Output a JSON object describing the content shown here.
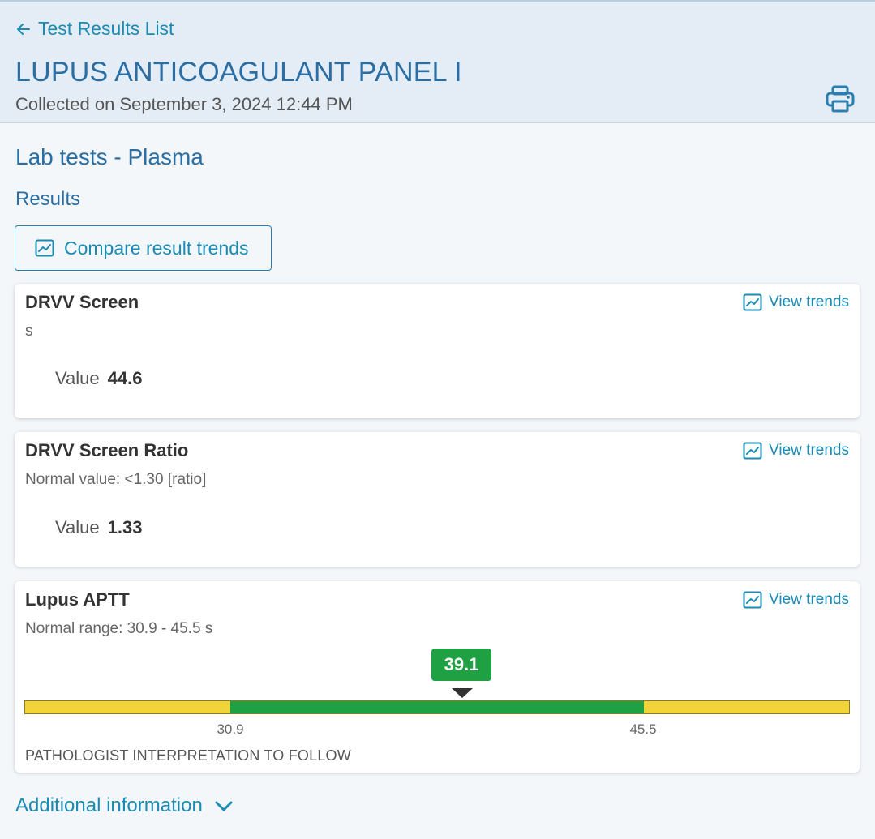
{
  "header": {
    "back_label": "Test Results List",
    "title": "LUPUS ANTICOAGULANT PANEL I",
    "collected": "Collected on September 3, 2024 12:44 PM",
    "print_icon": "printer-icon"
  },
  "section_title": "Lab tests - Plasma",
  "results_title": "Results",
  "compare_button": {
    "label": "Compare result trends",
    "icon": "trend-chart-icon"
  },
  "colors": {
    "accent": "#1a8bb3",
    "title": "#2a6ea3",
    "normal": "#1ea043",
    "abnormal": "#f2d43a"
  },
  "results": [
    {
      "name": "DRVV Screen",
      "subtitle": "s",
      "value_label": "Value",
      "value": "44.6",
      "trend_label": "View trends"
    },
    {
      "name": "DRVV Screen Ratio",
      "subtitle": "Normal value: <1.30 [ratio]",
      "value_label": "Value",
      "value": "1.33",
      "trend_label": "View trends"
    },
    {
      "name": "Lupus APTT",
      "subtitle": "Normal range: 30.9 - 45.5 s",
      "value": "39.1",
      "range_low": "30.9",
      "range_high": "45.5",
      "interpretation": "PATHOLOGIST INTERPRETATION TO FOLLOW",
      "trend_label": "View trends"
    }
  ],
  "additional_info": {
    "label": "Additional information",
    "icon": "chevron-down-icon"
  }
}
